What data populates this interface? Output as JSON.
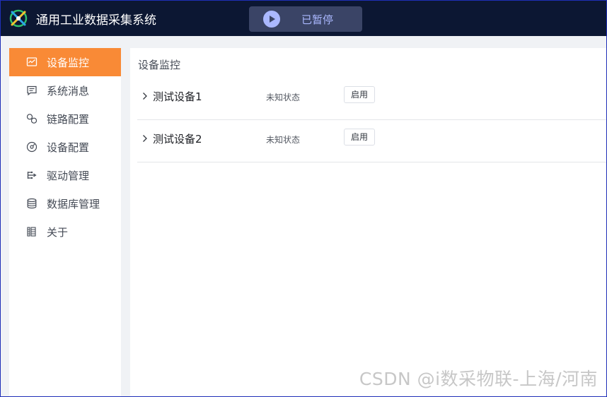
{
  "header": {
    "app_title": "通用工业数据采集系统",
    "logo_icon": "logo-icon",
    "pause_button": {
      "label": "已暂停",
      "icon": "play-icon"
    }
  },
  "sidebar": {
    "active_color": "#f98a36",
    "items": [
      {
        "label": "设备监控",
        "icon": "monitor-icon",
        "active": true
      },
      {
        "label": "系统消息",
        "icon": "message-icon",
        "active": false
      },
      {
        "label": "链路配置",
        "icon": "link-icon",
        "active": false
      },
      {
        "label": "设备配置",
        "icon": "device-config-icon",
        "active": false
      },
      {
        "label": "驱动管理",
        "icon": "driver-icon",
        "active": false
      },
      {
        "label": "数据库管理",
        "icon": "database-icon",
        "active": false
      },
      {
        "label": "关于",
        "icon": "about-icon",
        "active": false
      }
    ]
  },
  "main": {
    "title": "设备监控",
    "devices": [
      {
        "name": "测试设备1",
        "status": "未知状态",
        "action": "启用"
      },
      {
        "name": "测试设备2",
        "status": "未知状态",
        "action": "启用"
      }
    ]
  },
  "watermark": "CSDN @i数采物联-上海/河南",
  "colors": {
    "header_bg": "#0c1733",
    "accent": "#f98a36",
    "pause_button_bg": "#3a4466",
    "pause_text": "#aab8ff"
  }
}
